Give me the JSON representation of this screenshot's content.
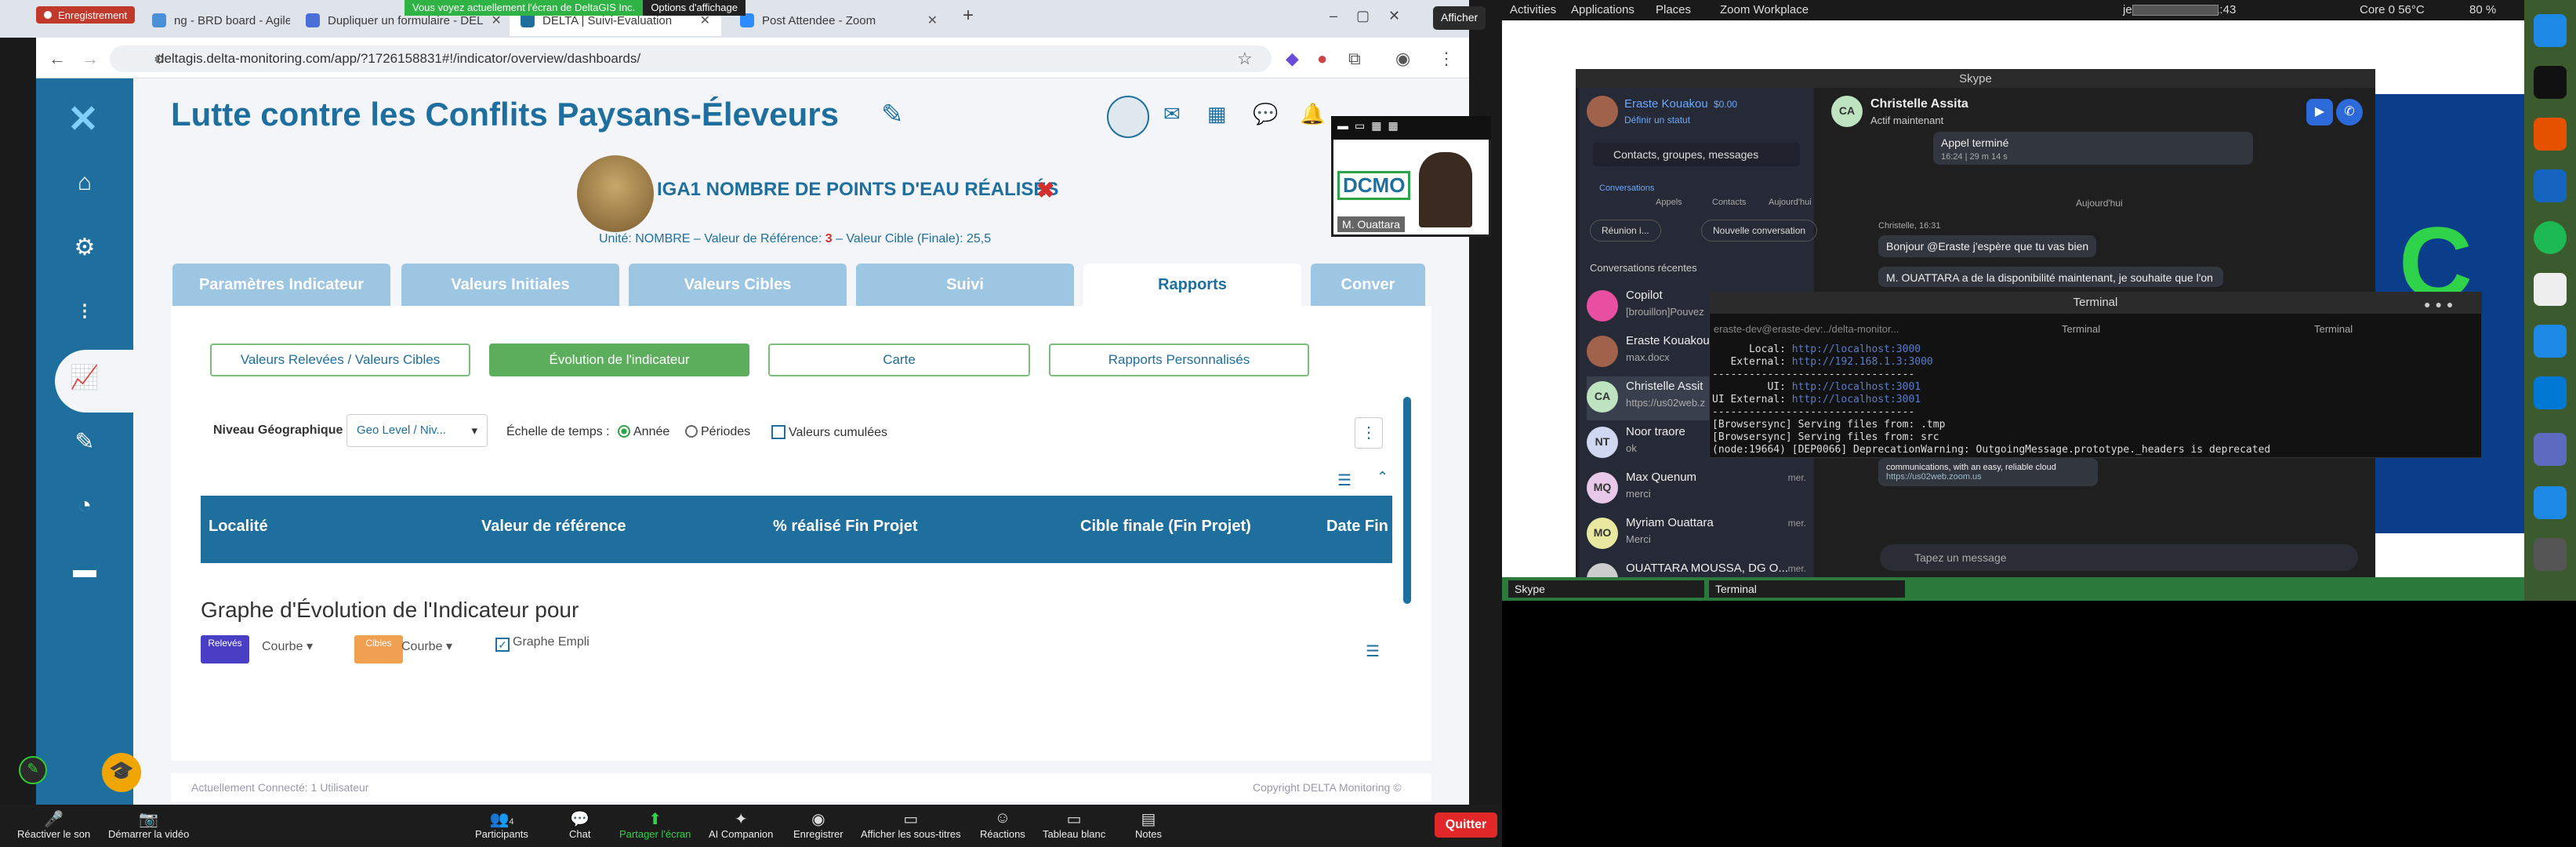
{
  "browser": {
    "tabs": [
      {
        "label": "Enregistrement",
        "fav": "#c0392b"
      },
      {
        "label": "ng - BRD board - Agile",
        "fav": "#4a90d9"
      },
      {
        "label": "Dupliquer un formulaire - DEL",
        "fav": "#4a6fd9"
      },
      {
        "label": "DELTA | Suivi-Evaluation",
        "fav": "#1e6f9d"
      },
      {
        "label": "Post Attendee - Zoom",
        "fav": "#2d8cff"
      }
    ],
    "new_tab": "+",
    "share_banner": "Vous voyez actuellement l'écran de DeltaGIS Inc.",
    "display_options": "Options d'affichage",
    "afficher": "Afficher",
    "url": "deltagis.delta-monitoring.com/app/?1726158831#!/indicator/overview/dashboards/"
  },
  "app": {
    "title": "Lutte contre les Conflits Paysans-Éleveurs",
    "indicator_title": "IGA1 NOMBRE DE POINTS D'EAU RÉALISÉS",
    "unit_prefix": "Unité: NOMBRE – Valeur de Référence: ",
    "ref_value": "3",
    "unit_suffix": " – Valeur Cible (Finale): 25,5",
    "tabs": [
      "Paramètres Indicateur",
      "Valeurs Initiales",
      "Valeurs Cibles",
      "Suivi",
      "Rapports",
      "Conver"
    ],
    "report_buttons": [
      "Valeurs Relevées / Valeurs Cibles",
      "Évolution de l'indicateur",
      "Carte",
      "Rapports Personnalisés"
    ],
    "geo_label": "Niveau Géographique",
    "geo_select": "Geo Level / Niv...",
    "time_label": "Échelle de temps :",
    "opt_year": "Année",
    "opt_periods": "Périodes",
    "opt_cumul": "Valeurs cumulées",
    "table_headers": [
      "Localité",
      "Valeur de référence",
      "% réalisé Fin Projet",
      "Cible finale (Fin Projet)",
      "Date Fin"
    ],
    "graph_title": "Graphe d'Évolution de l'Indicateur pour",
    "legend": [
      {
        "label": "Relevés",
        "color": "#4a3fc4",
        "type": "Courbe"
      },
      {
        "label": "Cibles",
        "color": "#f0a050",
        "type": "Courbe"
      }
    ],
    "graphe_empli": "Graphe Empli",
    "footer_left": "Actuellement Connecté: 1 Utilisateur",
    "footer_right": "Copyright DELTA Monitoring ©"
  },
  "zoom": {
    "items": [
      "Réactiver le son",
      "Démarrer la vidéo",
      "Participants",
      "Chat",
      "Partager l'écran",
      "AI Companion",
      "Enregistrer",
      "Afficher les sous-titres",
      "Réactions",
      "Tableau blanc",
      "Notes"
    ],
    "participants_count": "4",
    "quit": "Quitter",
    "video_name": "M. Ouattara",
    "logo_text": "DCMO"
  },
  "gnome": {
    "activities": "Activities",
    "applications": "Applications",
    "places": "Places",
    "zoom_workplace": "Zoom Workplace",
    "clock": "jeu. sept. 12  16:41:43",
    "cpu": "Core 0 56°C",
    "bat": "80 %",
    "taskbar": [
      "Skype",
      "Terminal"
    ]
  },
  "skype": {
    "title": "Skype",
    "user_name": "Eraste Kouakou",
    "balance": "$0.00",
    "status": "Définir un statut",
    "search_placeholder": "Contacts, groupes, messages",
    "nav": [
      "Conversations",
      "Appels",
      "Contacts",
      "Aujourd'hui"
    ],
    "meet": "Réunion i...",
    "new_conv": "Nouvelle conversation",
    "recent": "Conversations récentes",
    "conversations": [
      {
        "name": "Copilot",
        "preview": "[brouillon]Pouvez",
        "initials": "",
        "color": "#e94fa0",
        "time": ""
      },
      {
        "name": "Eraste Kouakou",
        "preview": "max.docx",
        "initials": "",
        "color": "#a0624a",
        "time": ""
      },
      {
        "name": "Christelle Assit",
        "preview": "https://us02web.z",
        "initials": "CA",
        "color": "#bde3c1",
        "time": ""
      },
      {
        "name": "Noor traore",
        "preview": "ok",
        "initials": "NT",
        "color": "#cfd8f0",
        "time": ""
      },
      {
        "name": "Max Quenum",
        "preview": "merci",
        "initials": "MQ",
        "color": "#e8c8e8",
        "time": "mer."
      },
      {
        "name": "Myriam Ouattara",
        "preview": "Merci",
        "initials": "MO",
        "color": "#e8e8a0",
        "time": "mer."
      },
      {
        "name": "OUATTARA MOUSSA, DG O...",
        "preview": "",
        "initials": "",
        "color": "#ccc",
        "time": "mer."
      }
    ],
    "chat_name": "Christelle Assita",
    "chat_status": "Actif maintenant",
    "call_ended": "Appel terminé",
    "call_time": "16:24 | 29 m 14 s",
    "today": "Aujourd'hui",
    "sender": "Christelle, 16:31",
    "msg1": "Bonjour @Eraste j'espère que tu vas bien",
    "msg2": "M. OUATTARA a de la disponibilité maintenant, je souhaite que l'on",
    "msg3": "communications, with an easy, reliable cloud",
    "link": "https://us02web.zoom.us",
    "input_placeholder": "Tapez un message"
  },
  "terminal": {
    "title": "Terminal",
    "path": "eraste-dev@eraste-dev:../delta-monitor...",
    "tabs": [
      "Terminal",
      "Terminal"
    ],
    "lines": [
      {
        "k": "      Local: ",
        "v": "http://localhost:3000"
      },
      {
        "k": "   External: ",
        "v": "http://192.168.1.3:3000"
      },
      {
        "k": "",
        "v": "---------------------------------"
      },
      {
        "k": "         UI: ",
        "v": "http://localhost:3001"
      },
      {
        "k": "UI External: ",
        "v": "http://localhost:3001"
      },
      {
        "k": "",
        "v": "---------------------------------"
      },
      {
        "k": "[Browsersync] Serving files from: ",
        "v": ".tmp"
      },
      {
        "k": "[Browsersync] Serving files from: ",
        "v": "src"
      },
      {
        "k": "(node:19664) [DEP0066] DeprecationWarning: OutgoingMessage.prototype._headers is deprecated",
        "v": ""
      }
    ]
  }
}
